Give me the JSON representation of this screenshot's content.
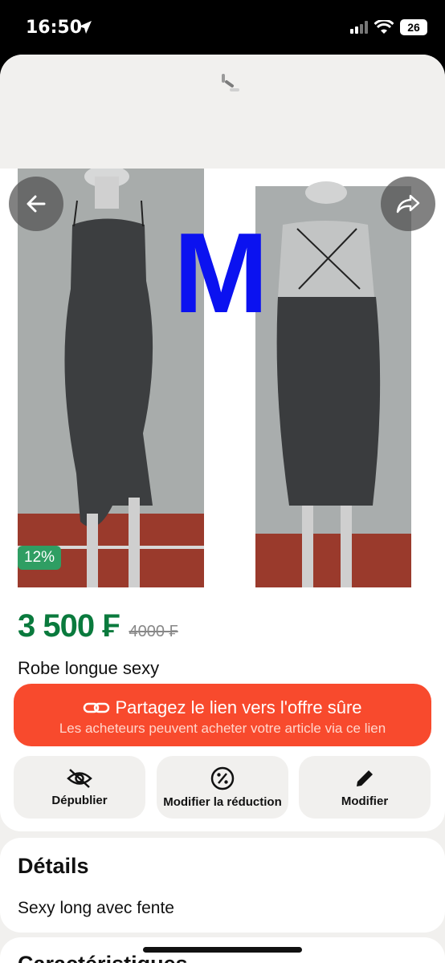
{
  "status": {
    "time": "16:50",
    "battery": "26"
  },
  "listing": {
    "photo_overlay_text": "M",
    "discount_badge": "12%",
    "price": "3 500 ₣",
    "old_price": "4000 ₣",
    "title": "Robe longue sexy"
  },
  "share": {
    "label": "Partagez le lien vers l'offre sûre",
    "sublabel": "Les acheteurs peuvent acheter votre article via ce lien"
  },
  "actions": [
    {
      "label": "Dépublier",
      "icon": "eye-off-icon"
    },
    {
      "label": "Modifier la réduction",
      "icon": "percent-icon"
    },
    {
      "label": "Modifier",
      "icon": "pencil-icon"
    }
  ],
  "details": {
    "title": "Détails",
    "text": "Sexy long avec fente"
  },
  "next_section": {
    "title": "Caractéristiques"
  },
  "colors": {
    "price": "#0a7a3d",
    "share_button": "#f84a2d",
    "badge": "#2f9e63",
    "overlay_letter": "#0b12f0"
  }
}
